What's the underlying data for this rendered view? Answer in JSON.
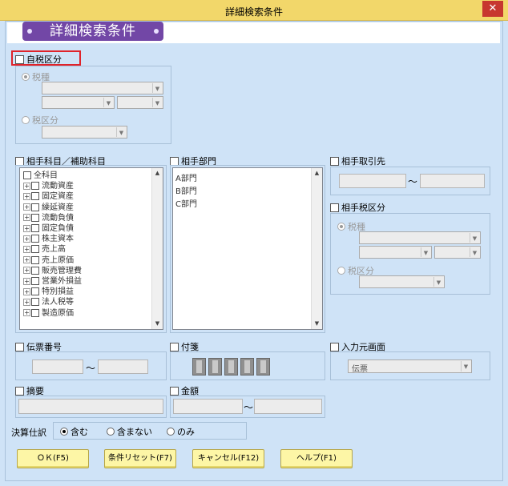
{
  "window": {
    "title": "詳細検索条件",
    "close": "✕"
  },
  "banner": {
    "title": "詳細検索条件"
  },
  "own_tax": {
    "label": "自税区分",
    "tax_type_label": "税種",
    "tax_class_label": "税区分"
  },
  "partner_account": {
    "label": "相手科目／補助科目",
    "items": [
      "全科目",
      "流動資産",
      "固定資産",
      "繰延資産",
      "流動負債",
      "固定負債",
      "株主資本",
      "売上高",
      "売上原価",
      "販売管理費",
      "営業外損益",
      "特別損益",
      "法人税等",
      "製造原価"
    ]
  },
  "partner_dept": {
    "label": "相手部門",
    "items": [
      "A部門",
      "B部門",
      "C部門"
    ]
  },
  "partner_client": {
    "label": "相手取引先",
    "tilde": "～"
  },
  "partner_tax": {
    "label": "相手税区分",
    "tax_type_label": "税種",
    "tax_class_label": "税区分"
  },
  "voucher_no": {
    "label": "伝票番号",
    "tilde": "～"
  },
  "sticky": {
    "label": "付箋"
  },
  "input_source": {
    "label": "入力元画面",
    "value": "伝票"
  },
  "summary": {
    "label": "摘要"
  },
  "amount": {
    "label": "金額",
    "tilde": "～"
  },
  "settlement": {
    "label": "決算仕訳",
    "options": [
      "含む",
      "含まない",
      "のみ"
    ],
    "selected": "含む"
  },
  "buttons": {
    "ok": "ＯＫ(F5)",
    "reset": "条件リセット(F7)",
    "cancel": "キャンセル(F12)",
    "help": "ヘルプ(F1)"
  },
  "colors": {
    "titlebar": "#f2d76a",
    "body": "#cfe3f7",
    "banner_pill": "#7247a6",
    "button": "#fdf6a6",
    "highlight": "#e0232a"
  }
}
